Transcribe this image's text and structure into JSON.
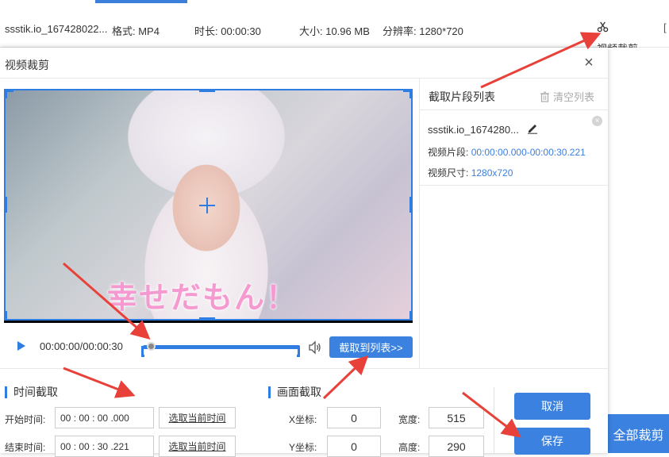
{
  "file_row": {
    "name": "ssstik.io_167428022...",
    "format": "格式: MP4",
    "duration": "时长: 00:00:30",
    "size": "大小: 10.96 MB",
    "resolution": "分辨率: 1280*720",
    "crop_link": "视频裁剪",
    "edge_char": "[",
    "crop_all": "全部裁剪"
  },
  "dialog": {
    "title": "视频裁剪",
    "close": "×",
    "video_caption": "幸せだもん！",
    "player": {
      "time": "00:00:00/00:00:30",
      "progress": 0.0,
      "add_to_list": "截取到列表>>"
    },
    "clip_list": {
      "header": "截取片段列表",
      "clear": "清空列表",
      "items": [
        {
          "name": "ssstik.io_1674280...",
          "segment_label": "视频片段:",
          "segment_value": "00:00:00.000-00:00:30.221",
          "size_label": "视频尺寸:",
          "size_value": "1280x720"
        }
      ]
    },
    "time_section": {
      "title": "时间截取",
      "start_label": "开始时间:",
      "start": {
        "h": "00",
        "m": "00",
        "s": "00",
        "ms": ".000"
      },
      "end_label": "结束时间:",
      "end": {
        "h": "00",
        "m": "00",
        "s": "30",
        "ms": ".221"
      },
      "pick_current": "选取当前时间"
    },
    "frame_section": {
      "title": "画面截取",
      "x_label": "X坐标:",
      "x": "0",
      "y_label": "Y坐标:",
      "y": "0",
      "w_label": "宽度:",
      "w": "515",
      "h_label": "高度:",
      "h": "290"
    },
    "cancel": "取消",
    "save": "保存"
  },
  "colors": {
    "accent": "#3b82e0",
    "link_value": "#3b7fdb"
  }
}
